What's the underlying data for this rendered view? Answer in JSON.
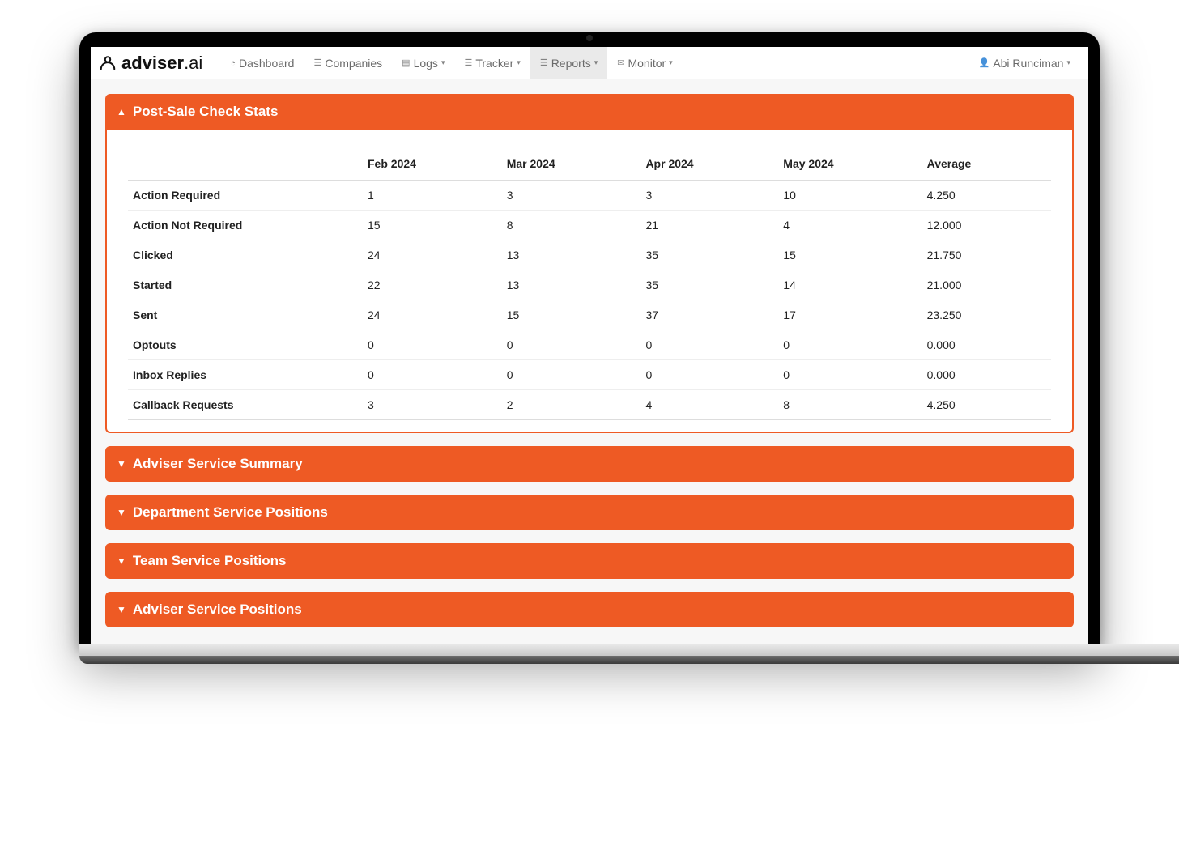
{
  "brand": {
    "name_strong": "adviser",
    "name_light": ".ai"
  },
  "nav": {
    "dashboard": "Dashboard",
    "companies": "Companies",
    "logs": "Logs",
    "tracker": "Tracker",
    "reports": "Reports",
    "monitor": "Monitor",
    "active_item": "Reports"
  },
  "user": {
    "name": "Abi Runciman"
  },
  "panel_stats": {
    "title": "Post-Sale Check Stats",
    "expanded": true,
    "columns": [
      "Feb 2024",
      "Mar 2024",
      "Apr 2024",
      "May 2024",
      "Average"
    ],
    "rows": [
      {
        "label": "Action Required",
        "values": [
          "1",
          "3",
          "3",
          "10",
          "4.250"
        ]
      },
      {
        "label": "Action Not Required",
        "values": [
          "15",
          "8",
          "21",
          "4",
          "12.000"
        ]
      },
      {
        "label": "Clicked",
        "values": [
          "24",
          "13",
          "35",
          "15",
          "21.750"
        ]
      },
      {
        "label": "Started",
        "values": [
          "22",
          "13",
          "35",
          "14",
          "21.000"
        ]
      },
      {
        "label": "Sent",
        "values": [
          "24",
          "15",
          "37",
          "17",
          "23.250"
        ]
      },
      {
        "label": "Optouts",
        "values": [
          "0",
          "0",
          "0",
          "0",
          "0.000"
        ]
      },
      {
        "label": "Inbox Replies",
        "values": [
          "0",
          "0",
          "0",
          "0",
          "0.000"
        ]
      },
      {
        "label": "Callback Requests",
        "values": [
          "3",
          "2",
          "4",
          "8",
          "4.250"
        ]
      }
    ]
  },
  "collapsed_panels": [
    "Adviser Service Summary",
    "Department Service Positions",
    "Team Service Positions",
    "Adviser Service Positions"
  ],
  "chart_data": {
    "type": "table",
    "title": "Post-Sale Check Stats",
    "categories": [
      "Feb 2024",
      "Mar 2024",
      "Apr 2024",
      "May 2024",
      "Average"
    ],
    "series": [
      {
        "name": "Action Required",
        "values": [
          1,
          3,
          3,
          10,
          4.25
        ]
      },
      {
        "name": "Action Not Required",
        "values": [
          15,
          8,
          21,
          4,
          12.0
        ]
      },
      {
        "name": "Clicked",
        "values": [
          24,
          13,
          35,
          15,
          21.75
        ]
      },
      {
        "name": "Started",
        "values": [
          22,
          13,
          35,
          14,
          21.0
        ]
      },
      {
        "name": "Sent",
        "values": [
          24,
          15,
          37,
          17,
          23.25
        ]
      },
      {
        "name": "Optouts",
        "values": [
          0,
          0,
          0,
          0,
          0.0
        ]
      },
      {
        "name": "Inbox Replies",
        "values": [
          0,
          0,
          0,
          0,
          0.0
        ]
      },
      {
        "name": "Callback Requests",
        "values": [
          3,
          2,
          4,
          8,
          4.25
        ]
      }
    ]
  }
}
